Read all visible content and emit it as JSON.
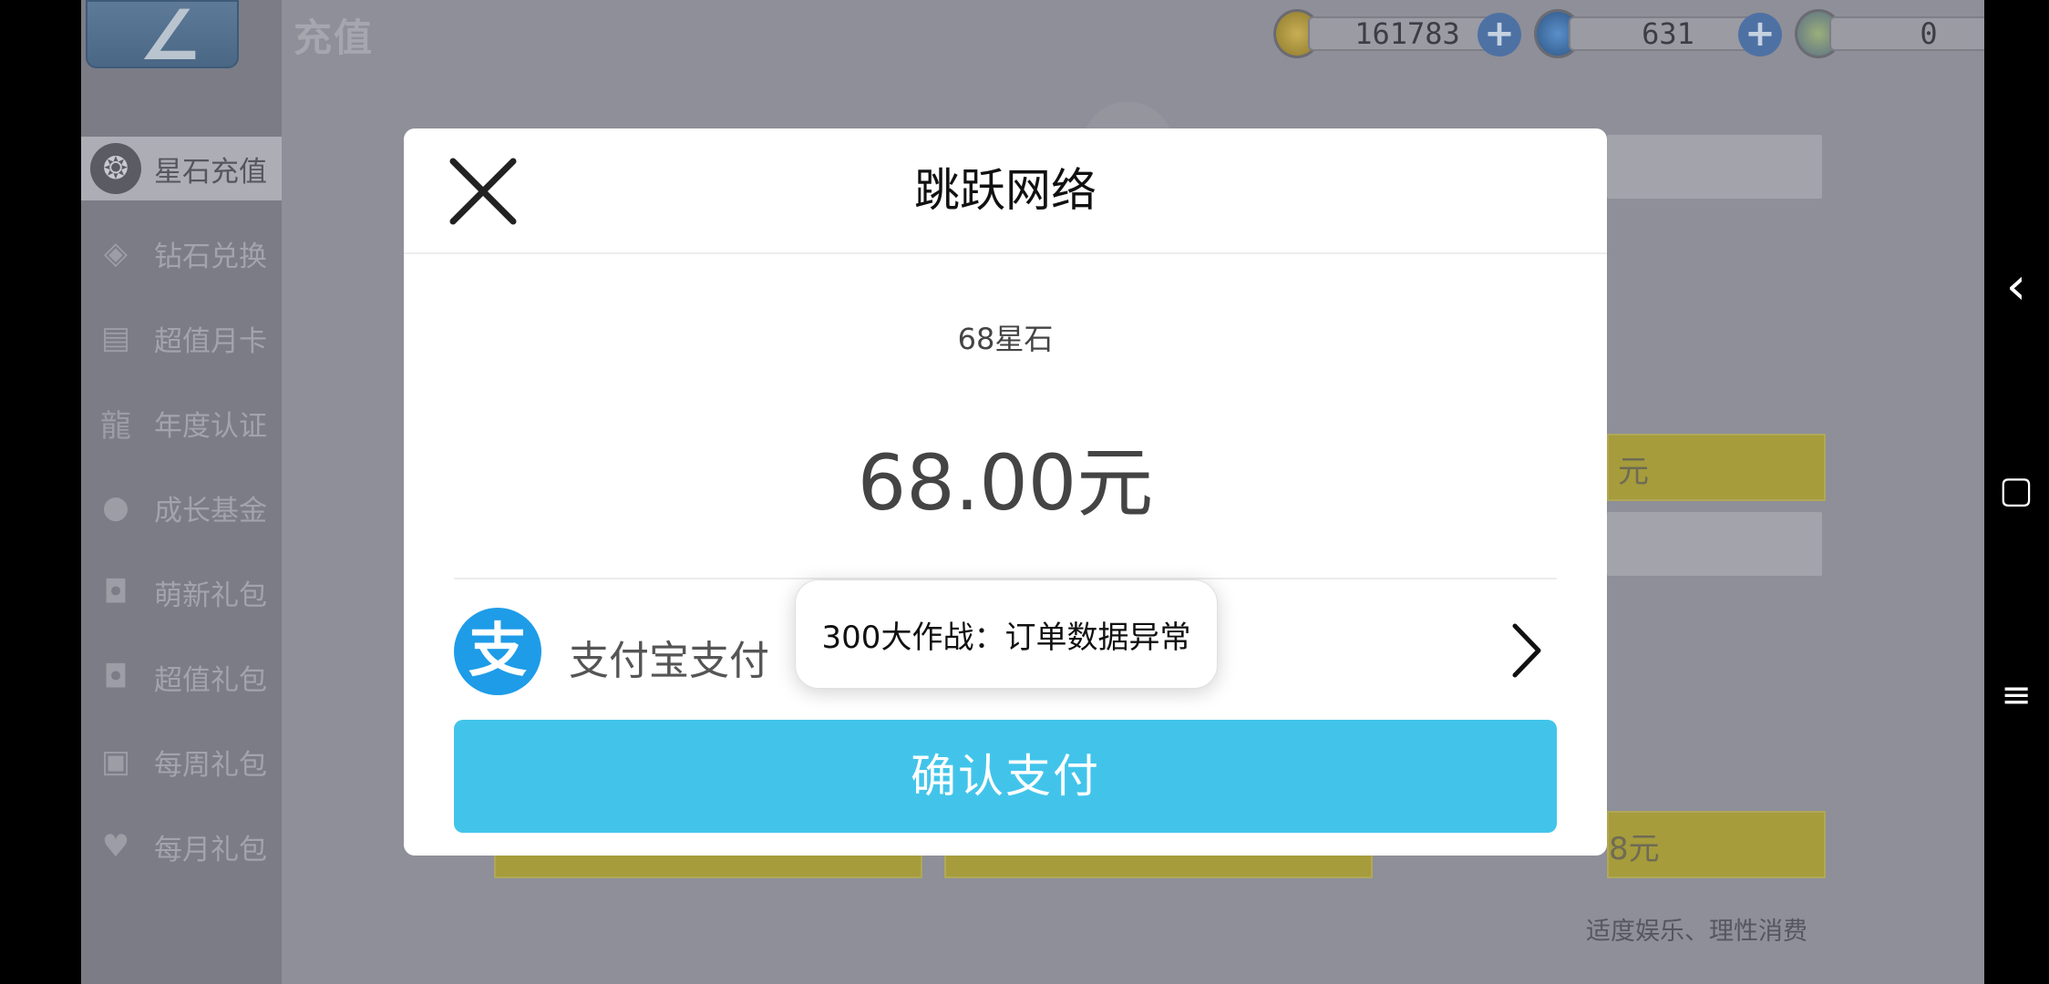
{
  "game": {
    "page_title": "充值",
    "back_glyph": "∠",
    "currencies": [
      {
        "name": "gold-coin",
        "value": "161783",
        "color": "#b49a3c"
      },
      {
        "name": "blue-crystal",
        "value": "631",
        "color": "#3d6fa8"
      },
      {
        "name": "rainbow-gem",
        "value": "0",
        "color": "#7a8f6a"
      }
    ],
    "plus_glyph": "+",
    "menu": [
      {
        "label": "星石充值",
        "icon": "star-stone-icon",
        "glyph": "❂",
        "active": true
      },
      {
        "label": "钻石兑换",
        "icon": "diamond-icon",
        "glyph": "◈",
        "active": false
      },
      {
        "label": "超值月卡",
        "icon": "monthly-card-icon",
        "glyph": "▤",
        "active": false
      },
      {
        "label": "年度认证",
        "icon": "dragon-badge-icon",
        "glyph": "龍",
        "active": false
      },
      {
        "label": "成长基金",
        "icon": "piggy-bank-icon",
        "glyph": "●",
        "active": false
      },
      {
        "label": "萌新礼包",
        "icon": "gift-bag-icon",
        "glyph": "◘",
        "active": false
      },
      {
        "label": "超值礼包",
        "icon": "gift-bag-icon",
        "glyph": "◘",
        "active": false
      },
      {
        "label": "每周礼包",
        "icon": "weekly-gift-icon",
        "glyph": "▣",
        "active": false
      },
      {
        "label": "每月礼包",
        "icon": "heart-gift-icon",
        "glyph": "♥",
        "active": false
      }
    ],
    "shop_price_1": "元",
    "shop_price_2": "8元",
    "footer_note": "适度娱乐、理性消费"
  },
  "dialog": {
    "title": "跳跃网络",
    "item_name": "68星石",
    "price": "68.00元",
    "pay_method": "支付宝支付",
    "alipay_glyph": "支",
    "confirm_label": "确认支付",
    "accent_color": "#42c4ea"
  },
  "toast": {
    "message": "300大作战：订单数据异常"
  },
  "system_nav": {
    "back_glyph": "‹",
    "home_glyph": "▢",
    "menu_glyph": "≡"
  }
}
